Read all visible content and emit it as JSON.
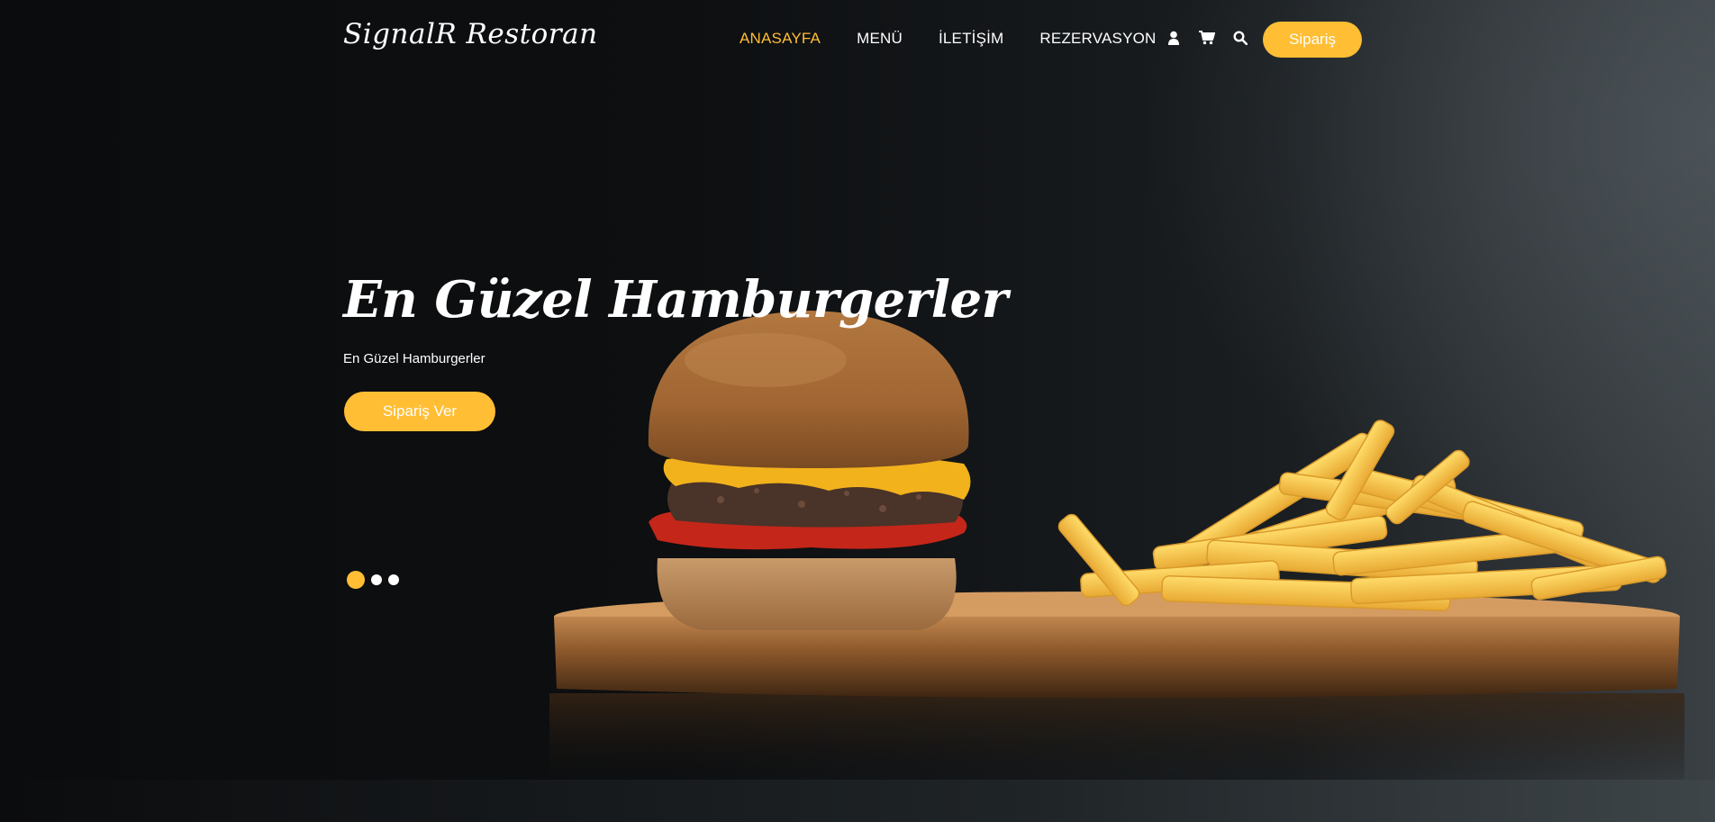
{
  "brand": {
    "name": "SignalR Restoran"
  },
  "nav": {
    "items": [
      {
        "label": "ANASAYFA",
        "active": true
      },
      {
        "label": "MENÜ",
        "active": false
      },
      {
        "label": "İLETİŞİM",
        "active": false
      },
      {
        "label": "REZERVASYON",
        "active": false
      }
    ]
  },
  "header": {
    "icons": [
      "user-icon",
      "cart-icon",
      "search-icon"
    ],
    "order_label": "Sipariş"
  },
  "hero": {
    "title": "En Güzel Hamburgerler",
    "subtitle": "En Güzel Hamburgerler",
    "cta_label": "Sipariş Ver",
    "slides": {
      "count": 3,
      "active_index": 0
    }
  },
  "colors": {
    "accent": "#ffbe33",
    "text": "#ffffff",
    "background": "#0c0d0f"
  }
}
